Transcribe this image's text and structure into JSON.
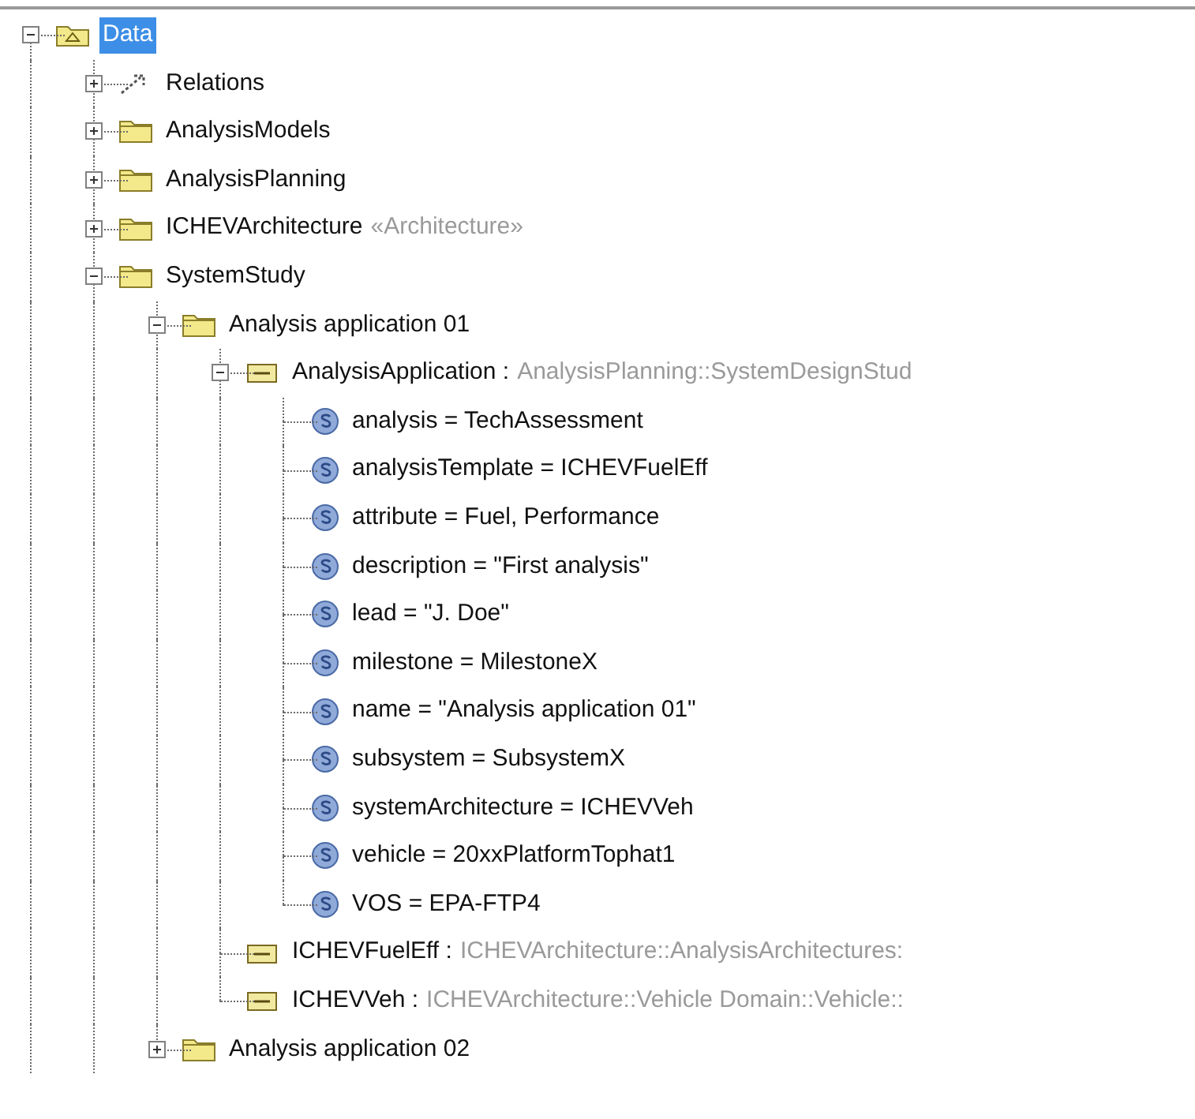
{
  "tree": {
    "nodes": [
      {
        "label": "Data",
        "kind": "model",
        "expanded": true,
        "selected": true,
        "more_siblings_below": true,
        "children": [
          {
            "label": "Relations",
            "kind": "relations",
            "expanded": false,
            "selected": false
          },
          {
            "label": "AnalysisModels",
            "kind": "package",
            "expanded": false,
            "selected": false
          },
          {
            "label": "AnalysisPlanning",
            "kind": "package",
            "expanded": false,
            "selected": false
          },
          {
            "label": "ICHEVArchitecture",
            "stereotype": "«Architecture»",
            "kind": "package",
            "expanded": false,
            "selected": false
          },
          {
            "label": "SystemStudy",
            "kind": "package",
            "expanded": true,
            "selected": false,
            "more_siblings_below": true,
            "children": [
              {
                "label": "Analysis application 01",
                "kind": "package",
                "expanded": true,
                "selected": false,
                "children": [
                  {
                    "label": "AnalysisApplication :",
                    "type": "AnalysisPlanning::SystemDesignStud",
                    "kind": "instance",
                    "expanded": true,
                    "selected": false,
                    "children": [
                      {
                        "label": "analysis = TechAssessment",
                        "kind": "slot",
                        "selected": false
                      },
                      {
                        "label": "analysisTemplate = ICHEVFuelEff",
                        "kind": "slot",
                        "selected": false
                      },
                      {
                        "label": "attribute = Fuel, Performance",
                        "kind": "slot",
                        "selected": false
                      },
                      {
                        "label": "description = \"First analysis\"",
                        "kind": "slot",
                        "selected": false
                      },
                      {
                        "label": "lead = \"J. Doe\"",
                        "kind": "slot",
                        "selected": false
                      },
                      {
                        "label": "milestone = MilestoneX",
                        "kind": "slot",
                        "selected": false
                      },
                      {
                        "label": "name = \"Analysis application 01\"",
                        "kind": "slot",
                        "selected": false
                      },
                      {
                        "label": "subsystem = SubsystemX",
                        "kind": "slot",
                        "selected": false
                      },
                      {
                        "label": "systemArchitecture = ICHEVVeh",
                        "kind": "slot",
                        "selected": false
                      },
                      {
                        "label": "vehicle = 20xxPlatformTophat1",
                        "kind": "slot",
                        "selected": false
                      },
                      {
                        "label": "VOS = EPA-FTP4",
                        "kind": "slot",
                        "selected": false
                      }
                    ]
                  },
                  {
                    "label": "ICHEVFuelEff :",
                    "type": "ICHEVArchitecture::AnalysisArchitectures:",
                    "kind": "instance",
                    "selected": false
                  },
                  {
                    "label": "ICHEVVeh :",
                    "type": "ICHEVArchitecture::Vehicle Domain::Vehicle::",
                    "kind": "instance",
                    "selected": false
                  }
                ]
              },
              {
                "label": "Analysis application 02",
                "kind": "package",
                "expanded": false,
                "selected": false
              }
            ]
          }
        ]
      }
    ]
  }
}
